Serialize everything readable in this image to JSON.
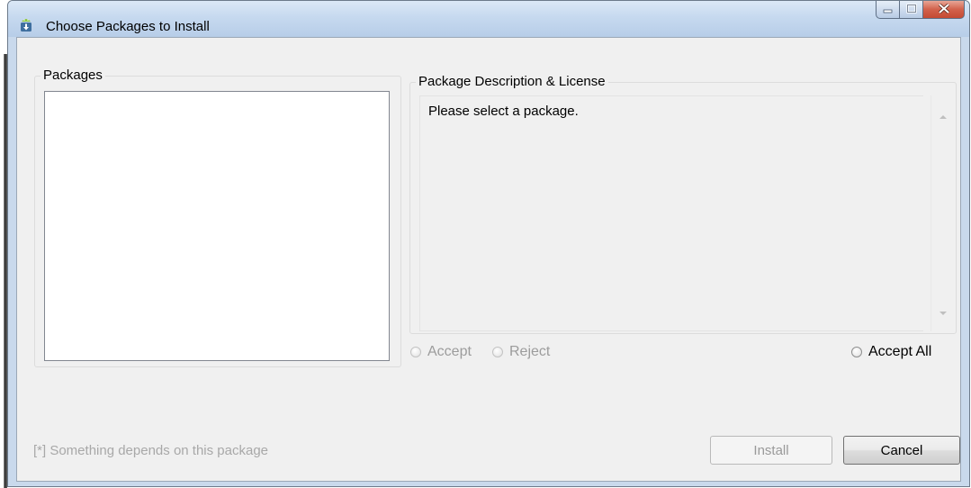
{
  "window": {
    "title": "Choose Packages to Install",
    "icon": "download-package-icon"
  },
  "caption_buttons": {
    "minimize_icon": "minimize-icon",
    "maximize_icon": "maximize-icon",
    "close_icon": "close-icon"
  },
  "packages": {
    "label": "Packages",
    "items": []
  },
  "description": {
    "label": "Package Description & License",
    "text": "Please select a package."
  },
  "license_options": {
    "accept": "Accept",
    "reject": "Reject",
    "accept_all": "Accept All"
  },
  "footnote": "[*] Something depends on this package",
  "buttons": {
    "install": "Install",
    "cancel": "Cancel"
  },
  "colors": {
    "titlebar": "#c6d9ef",
    "close_button": "#d2614b",
    "dialog_background": "#f0f0f0",
    "disabled_text": "#9c9c9c"
  }
}
